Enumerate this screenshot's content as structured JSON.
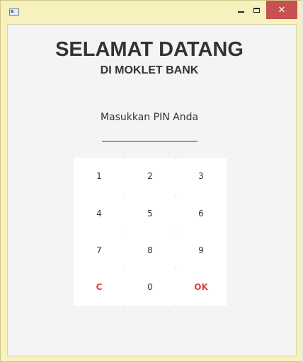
{
  "window": {
    "minimize_icon": "minimize-icon",
    "maximize_icon": "maximize-icon",
    "close_icon": "close-icon",
    "close_glyph": "✕",
    "close_color": "#c75050"
  },
  "header": {
    "title": "SELAMAT DATANG",
    "subtitle": "DI MOKLET BANK"
  },
  "pin": {
    "label": "Masukkan PIN Anda",
    "value": ""
  },
  "keypad": {
    "keys": [
      "1",
      "2",
      "3",
      "4",
      "5",
      "6",
      "7",
      "8",
      "9",
      "C",
      "0",
      "OK"
    ],
    "accent_color": "#d8413e"
  }
}
